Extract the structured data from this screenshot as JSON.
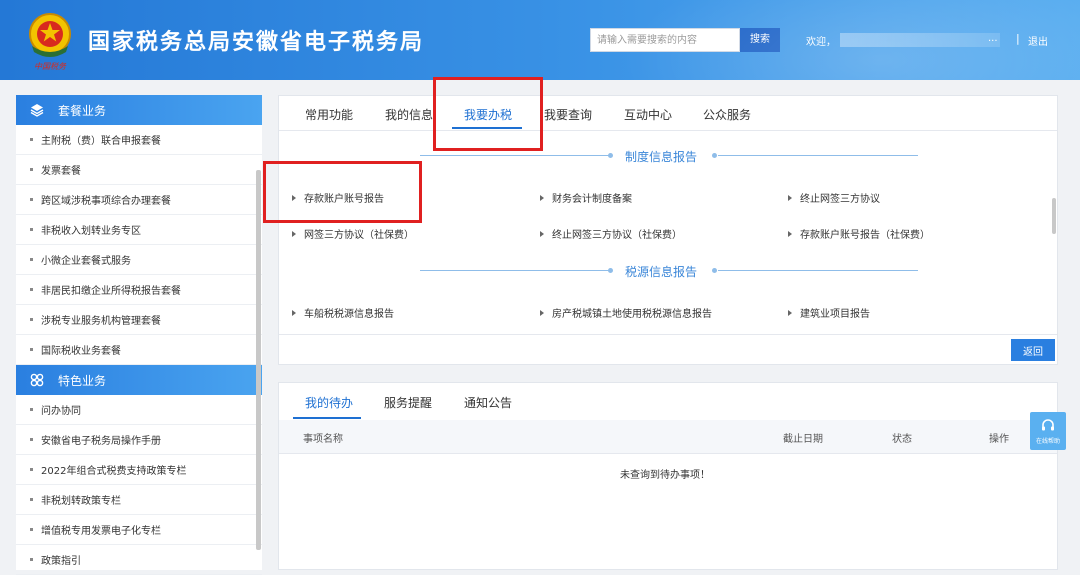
{
  "header": {
    "title": "国家税务总局安徽省电子税务局",
    "emblem_text": "中国税务",
    "search_placeholder": "请输入需要搜索的内容",
    "search_button": "搜索",
    "welcome": "欢迎，",
    "username_suffix": "...",
    "separator": "|",
    "logout": "退出"
  },
  "sidebar": {
    "groups": [
      {
        "title": "套餐业务",
        "icon": "layers-icon",
        "items": [
          "主附税（费）联合申报套餐",
          "发票套餐",
          "跨区域涉税事项综合办理套餐",
          "非税收入划转业务专区",
          "小微企业套餐式服务",
          "非居民扣缴企业所得税报告套餐",
          "涉税专业服务机构管理套餐",
          "国际税收业务套餐"
        ]
      },
      {
        "title": "特色业务",
        "icon": "grid-icon",
        "items": [
          "问办协同",
          "安徽省电子税务局操作手册",
          "2022年组合式税费支持政策专栏",
          "非税划转政策专栏",
          "增值税专用发票电子化专栏",
          "政策指引"
        ]
      }
    ]
  },
  "main_tabs": [
    "常用功能",
    "我的信息",
    "我要办税",
    "我要查询",
    "互动中心",
    "公众服务"
  ],
  "active_tab": "我要办税",
  "sections": [
    {
      "title": "制度信息报告",
      "items": [
        "存款账户账号报告",
        "财务会计制度备案",
        "终止网签三方协议",
        "网签三方协议（社保费）",
        "终止网签三方协议（社保费）",
        "存款账户账号报告（社保费）"
      ]
    },
    {
      "title": "税源信息报告",
      "items": [
        "车船税税源信息报告",
        "房产税城镇土地使用税税源信息报告",
        "建筑业项目报告"
      ]
    }
  ],
  "back_button": "返回",
  "bottom_tabs": [
    "我的待办",
    "服务提醒",
    "通知公告"
  ],
  "table_headers": [
    "事项名称",
    "截止日期",
    "状态",
    "操作"
  ],
  "empty_message": "未查询到待办事项！",
  "float_service_label": "在线帮助",
  "colors": {
    "header_blue": "#2478d6",
    "accent_blue": "#1e70d2",
    "highlight_red": "#e02020"
  }
}
